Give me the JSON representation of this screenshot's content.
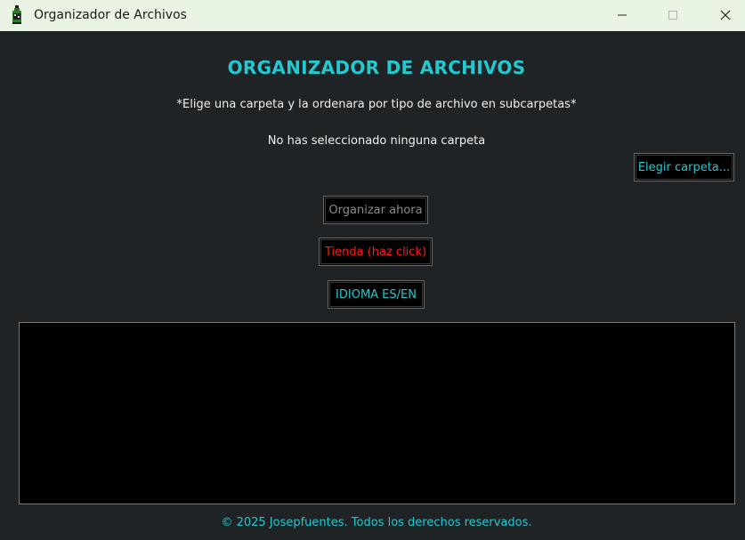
{
  "window": {
    "title": "Organizador de Archivos",
    "app_icon": "bottle-icon",
    "controls": {
      "minimize_icon": "minimize-icon",
      "maximize_icon": "maximize-icon",
      "close_icon": "close-icon"
    }
  },
  "main": {
    "heading": "ORGANIZADOR DE ARCHIVOS",
    "subtitle": "*Elige una carpeta y la ordenara por tipo de archivo en subcarpetas*",
    "status": "No has seleccionado ninguna carpeta",
    "buttons": {
      "choose_folder": "Elegir carpeta...",
      "organize_now": "Organizar ahora",
      "store": "Tienda (haz click)",
      "language": "IDIOMA ES/EN"
    },
    "footer": "© 2025 Josepfuentes. Todos los derechos reservados."
  },
  "colors": {
    "background": "#202325",
    "accent": "#22c9cf",
    "store_text": "#ff1a1a",
    "disabled_text": "#8a8a8a",
    "titlebar": "#eaf4e4"
  }
}
